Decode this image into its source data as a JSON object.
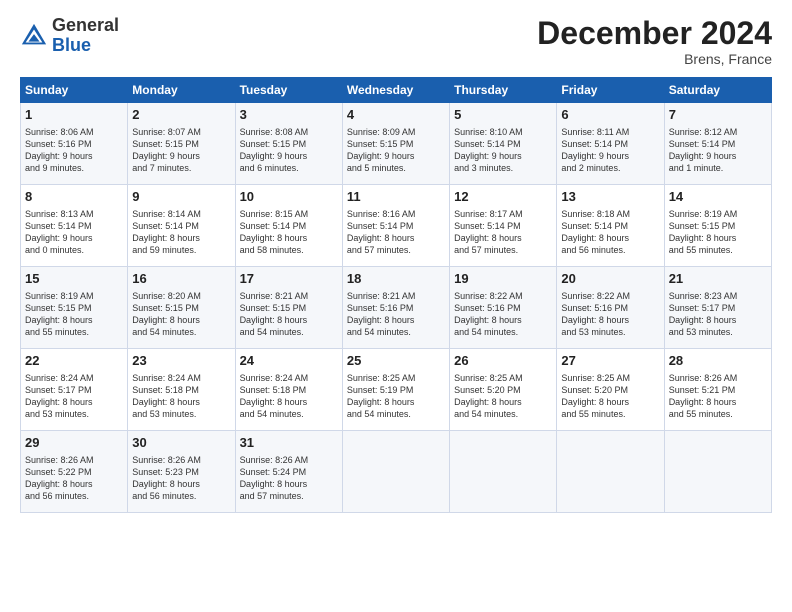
{
  "header": {
    "logo_general": "General",
    "logo_blue": "Blue",
    "month_title": "December 2024",
    "location": "Brens, France"
  },
  "days_of_week": [
    "Sunday",
    "Monday",
    "Tuesday",
    "Wednesday",
    "Thursday",
    "Friday",
    "Saturday"
  ],
  "weeks": [
    [
      {
        "day": 1,
        "lines": [
          "Sunrise: 8:06 AM",
          "Sunset: 5:16 PM",
          "Daylight: 9 hours",
          "and 9 minutes."
        ]
      },
      {
        "day": 2,
        "lines": [
          "Sunrise: 8:07 AM",
          "Sunset: 5:15 PM",
          "Daylight: 9 hours",
          "and 7 minutes."
        ]
      },
      {
        "day": 3,
        "lines": [
          "Sunrise: 8:08 AM",
          "Sunset: 5:15 PM",
          "Daylight: 9 hours",
          "and 6 minutes."
        ]
      },
      {
        "day": 4,
        "lines": [
          "Sunrise: 8:09 AM",
          "Sunset: 5:15 PM",
          "Daylight: 9 hours",
          "and 5 minutes."
        ]
      },
      {
        "day": 5,
        "lines": [
          "Sunrise: 8:10 AM",
          "Sunset: 5:14 PM",
          "Daylight: 9 hours",
          "and 3 minutes."
        ]
      },
      {
        "day": 6,
        "lines": [
          "Sunrise: 8:11 AM",
          "Sunset: 5:14 PM",
          "Daylight: 9 hours",
          "and 2 minutes."
        ]
      },
      {
        "day": 7,
        "lines": [
          "Sunrise: 8:12 AM",
          "Sunset: 5:14 PM",
          "Daylight: 9 hours",
          "and 1 minute."
        ]
      }
    ],
    [
      {
        "day": 8,
        "lines": [
          "Sunrise: 8:13 AM",
          "Sunset: 5:14 PM",
          "Daylight: 9 hours",
          "and 0 minutes."
        ]
      },
      {
        "day": 9,
        "lines": [
          "Sunrise: 8:14 AM",
          "Sunset: 5:14 PM",
          "Daylight: 8 hours",
          "and 59 minutes."
        ]
      },
      {
        "day": 10,
        "lines": [
          "Sunrise: 8:15 AM",
          "Sunset: 5:14 PM",
          "Daylight: 8 hours",
          "and 58 minutes."
        ]
      },
      {
        "day": 11,
        "lines": [
          "Sunrise: 8:16 AM",
          "Sunset: 5:14 PM",
          "Daylight: 8 hours",
          "and 57 minutes."
        ]
      },
      {
        "day": 12,
        "lines": [
          "Sunrise: 8:17 AM",
          "Sunset: 5:14 PM",
          "Daylight: 8 hours",
          "and 57 minutes."
        ]
      },
      {
        "day": 13,
        "lines": [
          "Sunrise: 8:18 AM",
          "Sunset: 5:14 PM",
          "Daylight: 8 hours",
          "and 56 minutes."
        ]
      },
      {
        "day": 14,
        "lines": [
          "Sunrise: 8:19 AM",
          "Sunset: 5:15 PM",
          "Daylight: 8 hours",
          "and 55 minutes."
        ]
      }
    ],
    [
      {
        "day": 15,
        "lines": [
          "Sunrise: 8:19 AM",
          "Sunset: 5:15 PM",
          "Daylight: 8 hours",
          "and 55 minutes."
        ]
      },
      {
        "day": 16,
        "lines": [
          "Sunrise: 8:20 AM",
          "Sunset: 5:15 PM",
          "Daylight: 8 hours",
          "and 54 minutes."
        ]
      },
      {
        "day": 17,
        "lines": [
          "Sunrise: 8:21 AM",
          "Sunset: 5:15 PM",
          "Daylight: 8 hours",
          "and 54 minutes."
        ]
      },
      {
        "day": 18,
        "lines": [
          "Sunrise: 8:21 AM",
          "Sunset: 5:16 PM",
          "Daylight: 8 hours",
          "and 54 minutes."
        ]
      },
      {
        "day": 19,
        "lines": [
          "Sunrise: 8:22 AM",
          "Sunset: 5:16 PM",
          "Daylight: 8 hours",
          "and 54 minutes."
        ]
      },
      {
        "day": 20,
        "lines": [
          "Sunrise: 8:22 AM",
          "Sunset: 5:16 PM",
          "Daylight: 8 hours",
          "and 53 minutes."
        ]
      },
      {
        "day": 21,
        "lines": [
          "Sunrise: 8:23 AM",
          "Sunset: 5:17 PM",
          "Daylight: 8 hours",
          "and 53 minutes."
        ]
      }
    ],
    [
      {
        "day": 22,
        "lines": [
          "Sunrise: 8:24 AM",
          "Sunset: 5:17 PM",
          "Daylight: 8 hours",
          "and 53 minutes."
        ]
      },
      {
        "day": 23,
        "lines": [
          "Sunrise: 8:24 AM",
          "Sunset: 5:18 PM",
          "Daylight: 8 hours",
          "and 53 minutes."
        ]
      },
      {
        "day": 24,
        "lines": [
          "Sunrise: 8:24 AM",
          "Sunset: 5:18 PM",
          "Daylight: 8 hours",
          "and 54 minutes."
        ]
      },
      {
        "day": 25,
        "lines": [
          "Sunrise: 8:25 AM",
          "Sunset: 5:19 PM",
          "Daylight: 8 hours",
          "and 54 minutes."
        ]
      },
      {
        "day": 26,
        "lines": [
          "Sunrise: 8:25 AM",
          "Sunset: 5:20 PM",
          "Daylight: 8 hours",
          "and 54 minutes."
        ]
      },
      {
        "day": 27,
        "lines": [
          "Sunrise: 8:25 AM",
          "Sunset: 5:20 PM",
          "Daylight: 8 hours",
          "and 55 minutes."
        ]
      },
      {
        "day": 28,
        "lines": [
          "Sunrise: 8:26 AM",
          "Sunset: 5:21 PM",
          "Daylight: 8 hours",
          "and 55 minutes."
        ]
      }
    ],
    [
      {
        "day": 29,
        "lines": [
          "Sunrise: 8:26 AM",
          "Sunset: 5:22 PM",
          "Daylight: 8 hours",
          "and 56 minutes."
        ]
      },
      {
        "day": 30,
        "lines": [
          "Sunrise: 8:26 AM",
          "Sunset: 5:23 PM",
          "Daylight: 8 hours",
          "and 56 minutes."
        ]
      },
      {
        "day": 31,
        "lines": [
          "Sunrise: 8:26 AM",
          "Sunset: 5:24 PM",
          "Daylight: 8 hours",
          "and 57 minutes."
        ]
      },
      null,
      null,
      null,
      null
    ]
  ]
}
